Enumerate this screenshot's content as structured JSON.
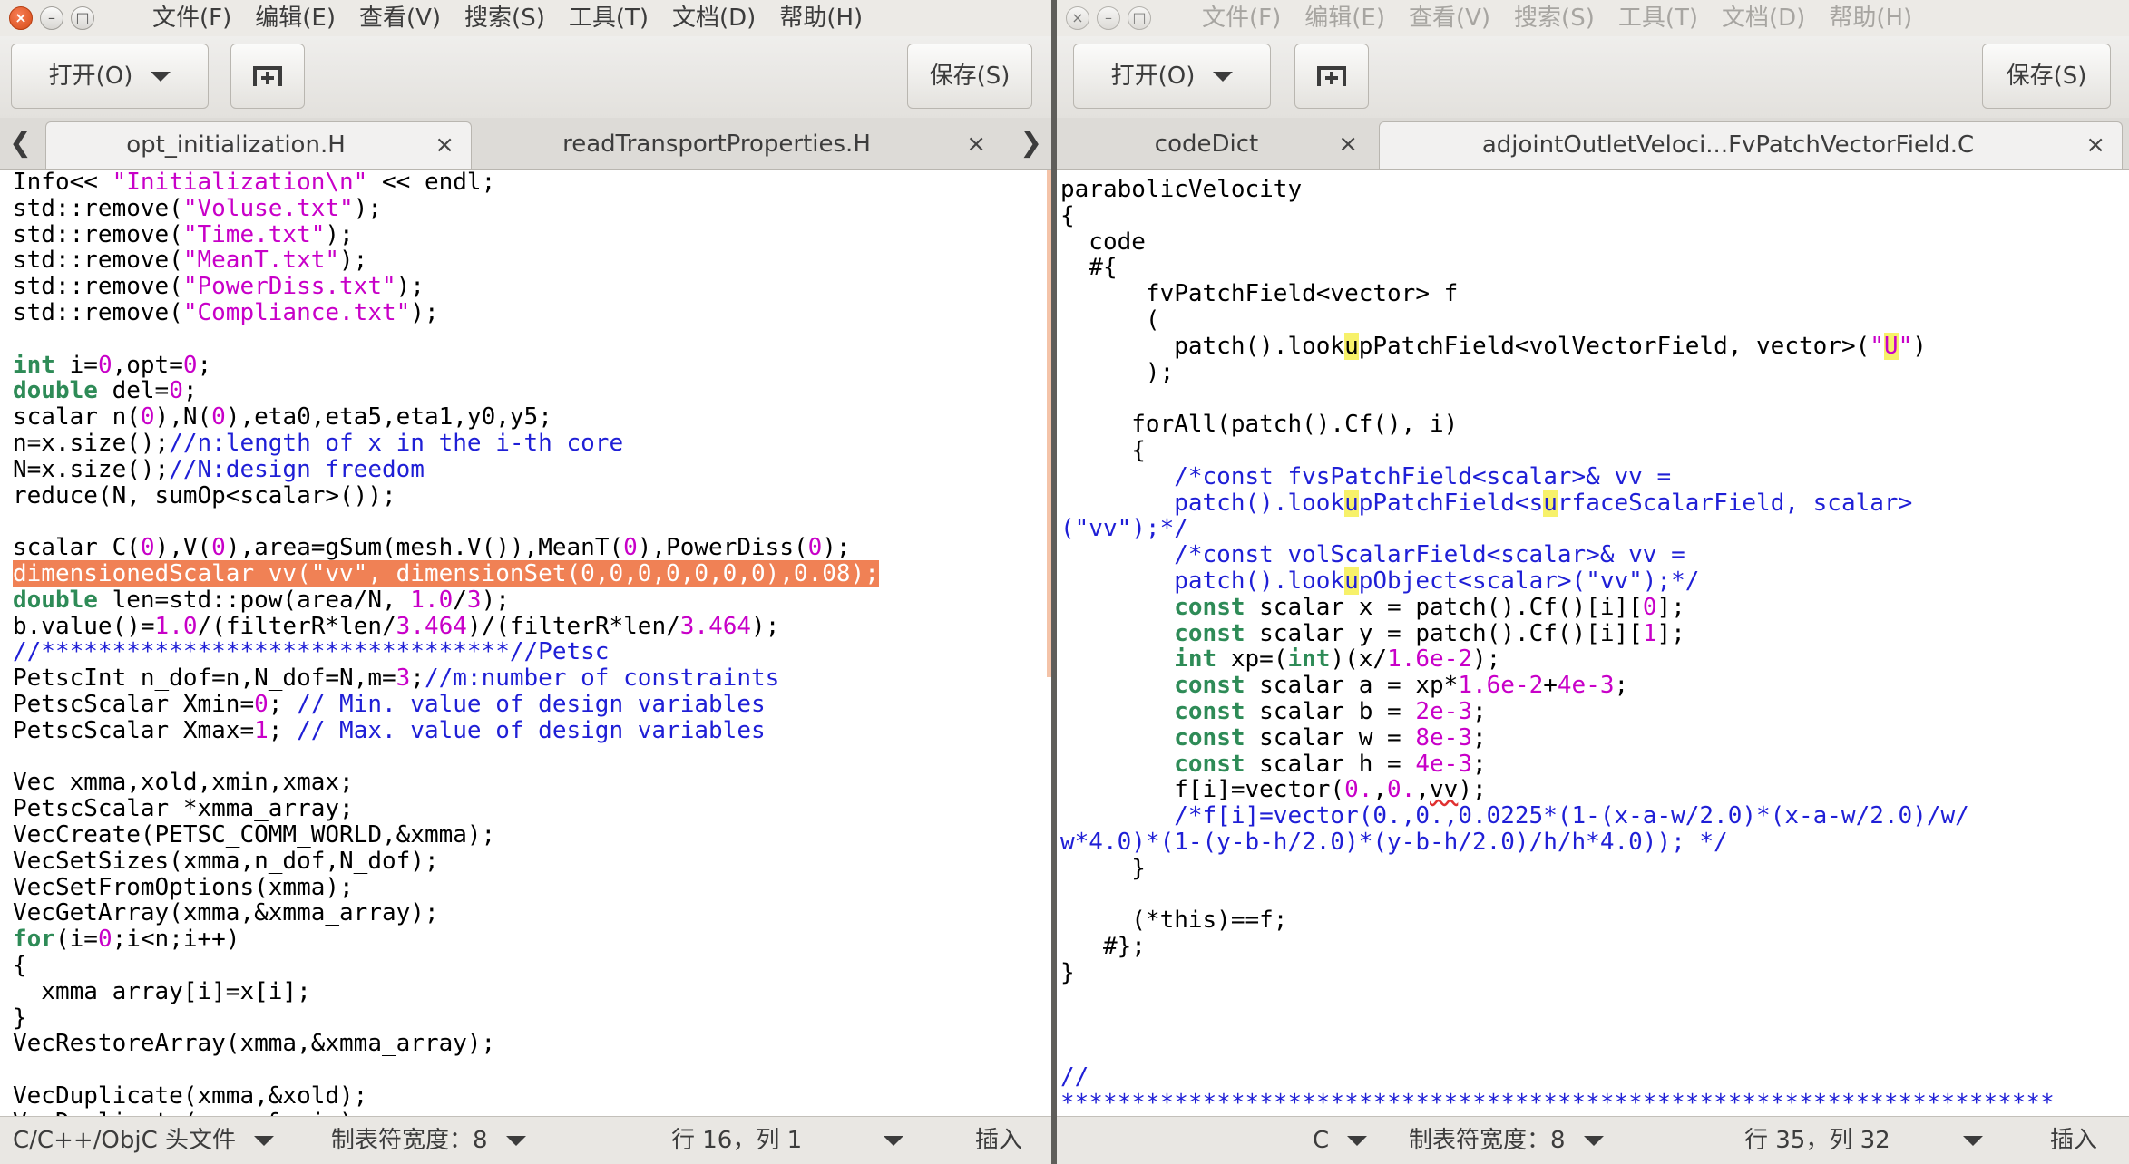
{
  "window_controls": {
    "close": "×",
    "minimize": "–",
    "maximize": "□"
  },
  "colors": {
    "accent_close": "#e95420",
    "line_highlight": "#f08155",
    "string": "#c800c8",
    "comment": "#1f1fd6",
    "keyword": "#2e8b57",
    "search_match": "#f7f16a"
  },
  "left_window": {
    "menu": [
      "文件(F)",
      "编辑(E)",
      "查看(V)",
      "搜索(S)",
      "工具(T)",
      "文档(D)",
      "帮助(H)"
    ],
    "toolbar": {
      "open_label": "打开(O)",
      "new_tab_icon": "new-document-icon",
      "save_label": "保存(S)"
    },
    "tabs": [
      {
        "label": "opt_initialization.H",
        "close": "×"
      },
      {
        "label": "readTransportProperties.H",
        "close": "×"
      }
    ],
    "tab_arrow_left": "❮",
    "tab_arrow_right": "❯",
    "code_lines": [
      [
        [
          "Info<< ",
          ""
        ],
        [
          "\"Initialization\\n\"",
          "s"
        ],
        [
          " << endl;",
          ""
        ]
      ],
      [
        [
          "std::remove(",
          ""
        ],
        [
          "\"Voluse.txt\"",
          "s"
        ],
        [
          ");",
          ""
        ]
      ],
      [
        [
          "std::remove(",
          ""
        ],
        [
          "\"Time.txt\"",
          "s"
        ],
        [
          ");",
          ""
        ]
      ],
      [
        [
          "std::remove(",
          ""
        ],
        [
          "\"MeanT.txt\"",
          "s"
        ],
        [
          ");",
          ""
        ]
      ],
      [
        [
          "std::remove(",
          ""
        ],
        [
          "\"PowerDiss.txt\"",
          "s"
        ],
        [
          ");",
          ""
        ]
      ],
      [
        [
          "std::remove(",
          ""
        ],
        [
          "\"Compliance.txt\"",
          "s"
        ],
        [
          ");",
          ""
        ]
      ],
      [],
      [
        [
          "int",
          "t"
        ],
        [
          " i=",
          ""
        ],
        [
          "0",
          "n"
        ],
        [
          ",opt=",
          ""
        ],
        [
          "0",
          "n"
        ],
        [
          ";",
          ""
        ]
      ],
      [
        [
          "double",
          "t"
        ],
        [
          " del=",
          ""
        ],
        [
          "0",
          "n"
        ],
        [
          ";",
          ""
        ]
      ],
      [
        [
          "scalar n(",
          ""
        ],
        [
          "0",
          "n"
        ],
        [
          "),N(",
          ""
        ],
        [
          "0",
          "n"
        ],
        [
          "),eta0,eta5,eta1,y0,y5;",
          ""
        ]
      ],
      [
        [
          "n=x.size();",
          ""
        ],
        [
          "//n:length of x in the i-th core",
          "c"
        ]
      ],
      [
        [
          "N=x.size();",
          ""
        ],
        [
          "//N:design freedom",
          "c"
        ]
      ],
      [
        [
          "reduce(N, sumOp<scalar>());",
          ""
        ]
      ],
      [],
      [
        [
          "scalar C(",
          ""
        ],
        [
          "0",
          "n"
        ],
        [
          "),V(",
          ""
        ],
        [
          "0",
          "n"
        ],
        [
          "),area=gSum(mesh.V()),MeanT(",
          ""
        ],
        [
          "0",
          "n"
        ],
        [
          "),PowerDiss(",
          ""
        ],
        [
          "0",
          "n"
        ],
        [
          ");",
          ""
        ]
      ],
      [
        [
          "dimensionedScalar vv(\"vv\", dimensionSet(0,0,0,0,0,0,0),0.08);",
          "hl"
        ]
      ],
      [
        [
          "double",
          "t"
        ],
        [
          " len=std::pow(area/N, ",
          ""
        ],
        [
          "1.0",
          "n"
        ],
        [
          "/",
          ""
        ],
        [
          "3",
          "n"
        ],
        [
          ");",
          ""
        ]
      ],
      [
        [
          "b.value()=",
          ""
        ],
        [
          "1.0",
          "n"
        ],
        [
          "/(filterR*len/",
          ""
        ],
        [
          "3.464",
          "n"
        ],
        [
          ")/(filterR*len/",
          ""
        ],
        [
          "3.464",
          "n"
        ],
        [
          ");",
          ""
        ]
      ],
      [
        [
          "//*********************************//Petsc",
          "c"
        ]
      ],
      [
        [
          "PetscInt n_dof=n,N_dof=N,m=",
          ""
        ],
        [
          "3",
          "n"
        ],
        [
          ";",
          ""
        ],
        [
          "//m:number of constraints",
          "c"
        ]
      ],
      [
        [
          "PetscScalar Xmin=",
          ""
        ],
        [
          "0",
          "n"
        ],
        [
          "; ",
          ""
        ],
        [
          "// Min. value of design variables",
          "c"
        ]
      ],
      [
        [
          "PetscScalar Xmax=",
          ""
        ],
        [
          "1",
          "n"
        ],
        [
          "; ",
          ""
        ],
        [
          "// Max. value of design variables",
          "c"
        ]
      ],
      [],
      [
        [
          "Vec xmma,xold,xmin,xmax;",
          ""
        ]
      ],
      [
        [
          "PetscScalar *xmma_array;",
          ""
        ]
      ],
      [
        [
          "VecCreate(PETSC_COMM_WORLD,&xmma);",
          ""
        ]
      ],
      [
        [
          "VecSetSizes(xmma,n_dof,N_dof);",
          ""
        ]
      ],
      [
        [
          "VecSetFromOptions(xmma);",
          ""
        ]
      ],
      [
        [
          "VecGetArray(xmma,&xmma_array);",
          ""
        ]
      ],
      [
        [
          "for",
          "k"
        ],
        [
          "(i=",
          ""
        ],
        [
          "0",
          "n"
        ],
        [
          ";i<n;i++)",
          ""
        ]
      ],
      [
        [
          "{",
          ""
        ]
      ],
      [
        [
          "  xmma_array[i]=x[i];",
          ""
        ]
      ],
      [
        [
          "}",
          ""
        ]
      ],
      [
        [
          "VecRestoreArray(xmma,&xmma_array);",
          ""
        ]
      ],
      [],
      [
        [
          "VecDuplicate(xmma,&xold);",
          ""
        ]
      ],
      [
        [
          "VecDuplicate(xmma,&xmin);",
          ""
        ]
      ]
    ],
    "status": {
      "language": "C/C++/ObjC 头文件",
      "tab_width": "制表符宽度：8",
      "position": "行 16，列 1",
      "mode": "插入"
    }
  },
  "right_window": {
    "menu": [
      "文件(F)",
      "编辑(E)",
      "查看(V)",
      "搜索(S)",
      "工具(T)",
      "文档(D)",
      "帮助(H)"
    ],
    "toolbar": {
      "open_label": "打开(O)",
      "new_tab_icon": "new-document-icon",
      "save_label": "保存(S)"
    },
    "tabs": [
      {
        "label": "codeDict",
        "close": "×"
      },
      {
        "label": "adjointOutletVeloci...FvPatchVectorField.C",
        "close": "×"
      }
    ],
    "code_lines": [
      [
        [
          "parabolicVelocity",
          ""
        ]
      ],
      [
        [
          "{",
          ""
        ]
      ],
      [
        [
          "  code",
          ""
        ]
      ],
      [
        [
          "  #{",
          ""
        ]
      ],
      [
        [
          "      fvPatchField<vector> f",
          ""
        ]
      ],
      [
        [
          "      (",
          ""
        ]
      ],
      [
        [
          "        patch().look",
          ""
        ],
        [
          "u",
          "y"
        ],
        [
          "pPatchField<volVectorField, vector>(",
          ""
        ],
        [
          "\"",
          "s"
        ],
        [
          "U",
          "sy"
        ],
        [
          "\"",
          "s"
        ],
        [
          ")",
          ""
        ]
      ],
      [
        [
          "      );",
          ""
        ]
      ],
      [],
      [
        [
          "     forAll(patch().Cf(), i)",
          ""
        ]
      ],
      [
        [
          "     {",
          ""
        ]
      ],
      [
        [
          "        /*const fvsPatchField<scalar>& vv =",
          "c"
        ]
      ],
      [
        [
          "        patch().look",
          "c"
        ],
        [
          "u",
          "cy"
        ],
        [
          "pPatchField<s",
          "c"
        ],
        [
          "u",
          "cy"
        ],
        [
          "rfaceScalarField, scalar>",
          "c"
        ]
      ],
      [
        [
          "(\"vv\");*/",
          "c"
        ]
      ],
      [
        [
          "        /*const volScalarField<scalar>& vv =",
          "c"
        ]
      ],
      [
        [
          "        patch().look",
          "c"
        ],
        [
          "u",
          "cy"
        ],
        [
          "pObject<scalar>(\"vv\");*/",
          "c"
        ]
      ],
      [
        [
          "        ",
          ""
        ],
        [
          "const",
          "t"
        ],
        [
          " scalar x = patch().Cf()[i][",
          ""
        ],
        [
          "0",
          "n"
        ],
        [
          "];",
          ""
        ]
      ],
      [
        [
          "        ",
          ""
        ],
        [
          "const",
          "t"
        ],
        [
          " scalar y = patch().Cf()[i][",
          ""
        ],
        [
          "1",
          "n"
        ],
        [
          "];",
          ""
        ]
      ],
      [
        [
          "        ",
          ""
        ],
        [
          "int",
          "t"
        ],
        [
          " xp=(",
          ""
        ],
        [
          "int",
          "t"
        ],
        [
          ")(x/",
          ""
        ],
        [
          "1.6e-2",
          "n"
        ],
        [
          ");",
          ""
        ]
      ],
      [
        [
          "        ",
          ""
        ],
        [
          "const",
          "t"
        ],
        [
          " scalar a = xp*",
          ""
        ],
        [
          "1.6e-2",
          "n"
        ],
        [
          "+",
          ""
        ],
        [
          "4e-3",
          "n"
        ],
        [
          ";",
          ""
        ]
      ],
      [
        [
          "        ",
          ""
        ],
        [
          "const",
          "t"
        ],
        [
          " scalar b = ",
          ""
        ],
        [
          "2e-3",
          "n"
        ],
        [
          ";",
          ""
        ]
      ],
      [
        [
          "        ",
          ""
        ],
        [
          "const",
          "t"
        ],
        [
          " scalar w = ",
          ""
        ],
        [
          "8e-3",
          "n"
        ],
        [
          ";",
          ""
        ]
      ],
      [
        [
          "        ",
          ""
        ],
        [
          "const",
          "t"
        ],
        [
          " scalar h = ",
          ""
        ],
        [
          "4e-3",
          "n"
        ],
        [
          ";",
          ""
        ]
      ],
      [
        [
          "        f[i]=vector(",
          ""
        ],
        [
          "0.",
          "n"
        ],
        [
          ",",
          ""
        ],
        [
          "0.",
          "n"
        ],
        [
          ",",
          ""
        ],
        [
          "vv",
          "sq"
        ],
        [
          ");",
          ""
        ]
      ],
      [
        [
          "        /*f[i]=vector(0.,0.,0.0225*(1-(x-a-w/2.0)*(x-a-w/2.0)/w/",
          "c"
        ]
      ],
      [
        [
          "w*4.0)*(1-(y-b-h/2.0)*(y-b-h/2.0)/h/h*4.0)); */",
          "c"
        ]
      ],
      [
        [
          "     }",
          ""
        ]
      ],
      [],
      [
        [
          "     (*this)==f;",
          ""
        ]
      ],
      [
        [
          "   #};",
          ""
        ]
      ],
      [
        [
          "}",
          ""
        ]
      ],
      [],
      [],
      [],
      [
        [
          "//",
          "c"
        ]
      ],
      [
        [
          "**********************************************************************",
          "c"
        ]
      ]
    ],
    "status": {
      "language": "C",
      "tab_width": "制表符宽度：8",
      "position": "行 35，列 32",
      "mode": "插入"
    }
  }
}
